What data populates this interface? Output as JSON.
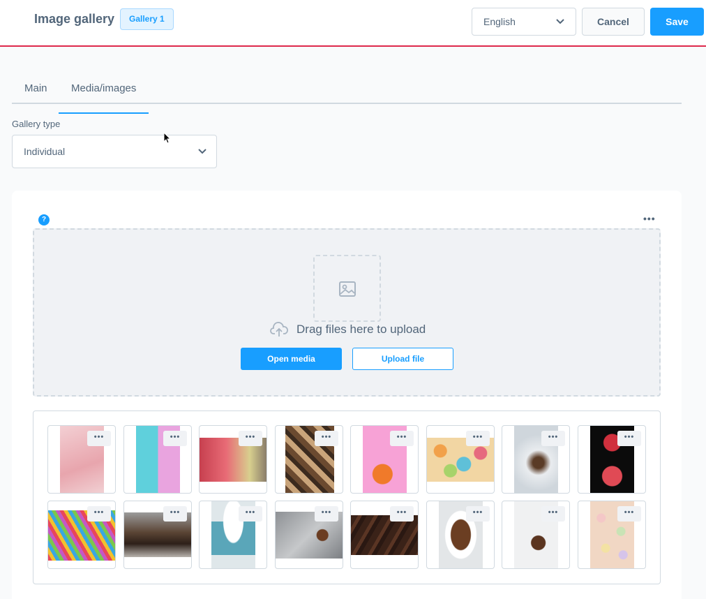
{
  "header": {
    "title": "Image gallery",
    "badge": "Gallery 1",
    "language": "English",
    "cancel_label": "Cancel",
    "save_label": "Save"
  },
  "tabs": [
    {
      "label": "Main",
      "active": false
    },
    {
      "label": "Media/images",
      "active": true
    }
  ],
  "gallery_type": {
    "label": "Gallery type",
    "value": "Individual"
  },
  "card": {
    "help_icon": "?",
    "menu_dots": "•••"
  },
  "dropzone": {
    "text": "Drag files here to upload",
    "open_media_label": "Open media",
    "upload_file_label": "Upload file"
  },
  "thumb_menu": "•••",
  "images": [
    {
      "subject": "pink heart cakes"
    },
    {
      "subject": "donuts on blue and pink"
    },
    {
      "subject": "colorful pastries"
    },
    {
      "subject": "chocolate squares"
    },
    {
      "subject": "heart on pink"
    },
    {
      "subject": "macarons"
    },
    {
      "subject": "plate with chocolates"
    },
    {
      "subject": "red hearts on black"
    },
    {
      "subject": "colorful sprinkle candies"
    },
    {
      "subject": "chocolate kisses"
    },
    {
      "subject": "hot cocoa with marshmallows"
    },
    {
      "subject": "chocolates on stone"
    },
    {
      "subject": "broken chocolate pieces"
    },
    {
      "subject": "bowl of chocolates"
    },
    {
      "subject": "chocolate pralines"
    },
    {
      "subject": "candy hearts"
    }
  ],
  "colors": {
    "accent": "#189eff",
    "header_border": "#de294c",
    "text": "#52667a",
    "border": "#d1d9e0"
  }
}
